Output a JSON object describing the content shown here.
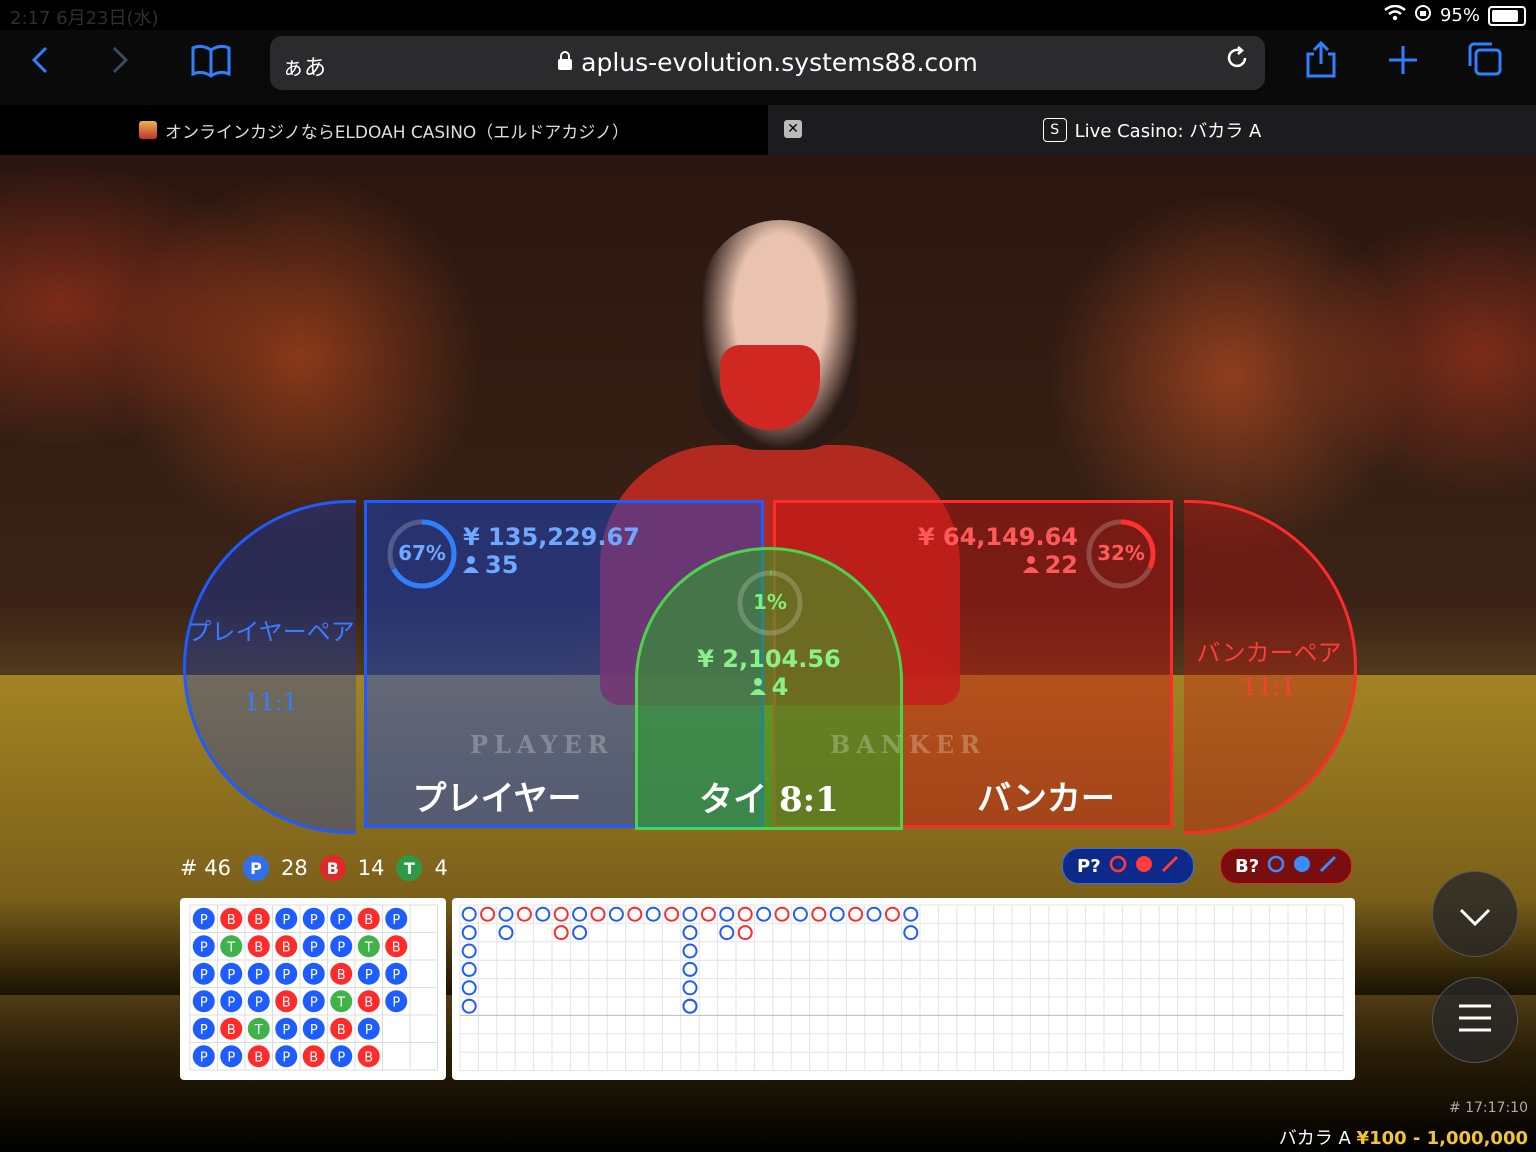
{
  "status": {
    "time": "2:17  6月23日(水)",
    "battery": "95%"
  },
  "browser": {
    "aa": "ぁあ",
    "url": "aplus-evolution.systems88.com",
    "tabs": [
      {
        "title": "オンラインカジノならELDOAH CASINO（エルドアカジノ）"
      },
      {
        "title": "Live Casino: バカラ A",
        "favicon": "S"
      }
    ]
  },
  "bets": {
    "player_pair": {
      "label": "プレイヤーペア",
      "payout": "11:1"
    },
    "player": {
      "label": "プレイヤー",
      "percent": "67%",
      "percent_value": 67,
      "amount": "¥ 135,229.67",
      "players": "35"
    },
    "tie": {
      "label": "タイ  8:1",
      "percent": "1%",
      "percent_value": 1,
      "amount": "¥ 2,104.56",
      "players": "4"
    },
    "banker": {
      "label": "バンカー",
      "percent": "32%",
      "percent_value": 32,
      "amount": "¥ 64,149.64",
      "players": "22"
    },
    "banker_pair": {
      "label": "バンカーペア",
      "payout": "11:1"
    }
  },
  "table_print": {
    "player": "PLAYER",
    "banker": "BANKER"
  },
  "stats": {
    "round": "# 46",
    "p": "28",
    "b": "14",
    "t": "4"
  },
  "predict": {
    "player": "P?",
    "banker": "B?"
  },
  "bead_road": [
    [
      "P",
      "P",
      "P",
      "P",
      "P",
      "P"
    ],
    [
      "B",
      "T",
      "P",
      "P",
      "B",
      "P"
    ],
    [
      "B",
      "B",
      "P",
      "P",
      "T",
      "B"
    ],
    [
      "P",
      "B",
      "P",
      "B",
      "P",
      "P"
    ],
    [
      "P",
      "P",
      "P",
      "P",
      "P",
      "B"
    ],
    [
      "P",
      "P",
      "B",
      "T",
      "B",
      "P"
    ],
    [
      "B",
      "T",
      "P",
      "B",
      "P",
      "B"
    ],
    [
      "P",
      "B",
      "P",
      "P",
      "",
      ""
    ]
  ],
  "colors": {
    "player": "#1e5cff",
    "banker": "#ff2a2a",
    "tie": "#3fb24a"
  },
  "footer": {
    "game_id": "# 17:17:10",
    "table": "バカラ A",
    "limits": "¥100 - 1,000,000"
  }
}
